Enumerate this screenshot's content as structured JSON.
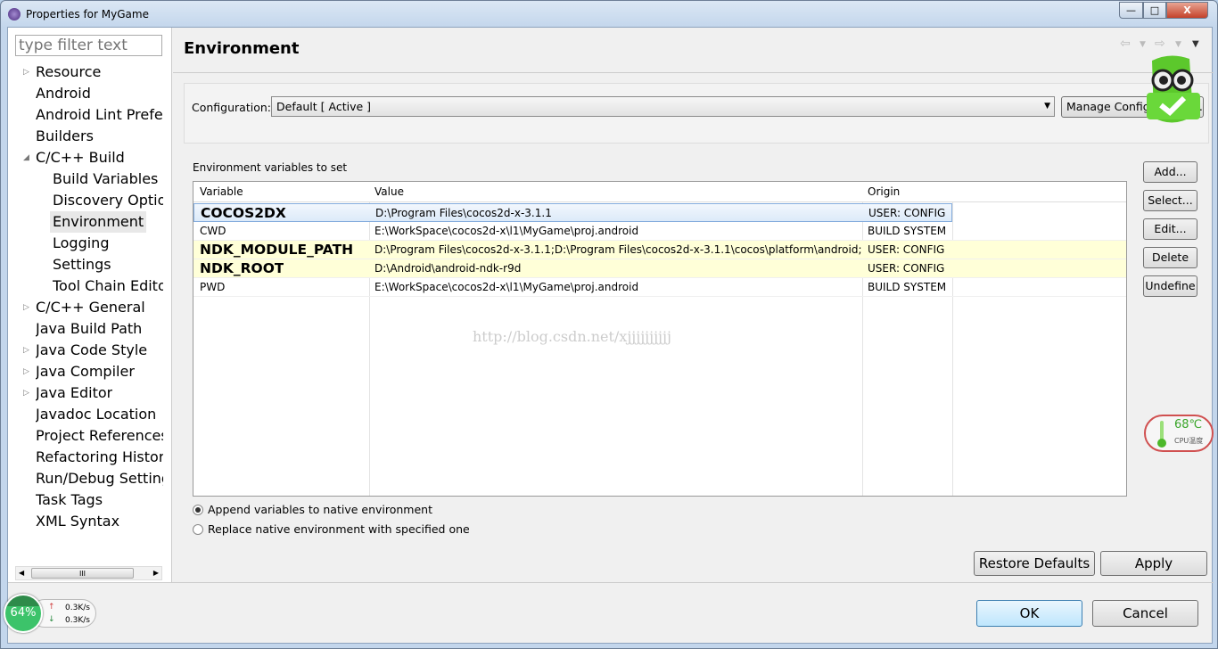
{
  "window": {
    "title": "Properties for MyGame",
    "minimize": "—",
    "maximize": "□",
    "close": "X"
  },
  "sidebar": {
    "filter_placeholder": "type filter text",
    "items": [
      {
        "label": "Resource",
        "level": 1,
        "expandable": true
      },
      {
        "label": "Android",
        "level": 1
      },
      {
        "label": "Android Lint Preferences",
        "level": 1
      },
      {
        "label": "Builders",
        "level": 1
      },
      {
        "label": "C/C++ Build",
        "level": 1,
        "expanded": true
      },
      {
        "label": "Build Variables",
        "level": 2
      },
      {
        "label": "Discovery Options",
        "level": 2
      },
      {
        "label": "Environment",
        "level": 2,
        "selected": true
      },
      {
        "label": "Logging",
        "level": 2
      },
      {
        "label": "Settings",
        "level": 2
      },
      {
        "label": "Tool Chain Editor",
        "level": 2
      },
      {
        "label": "C/C++ General",
        "level": 1,
        "expandable": true
      },
      {
        "label": "Java Build Path",
        "level": 1
      },
      {
        "label": "Java Code Style",
        "level": 1,
        "expandable": true
      },
      {
        "label": "Java Compiler",
        "level": 1,
        "expandable": true
      },
      {
        "label": "Java Editor",
        "level": 1,
        "expandable": true
      },
      {
        "label": "Javadoc Location",
        "level": 1
      },
      {
        "label": "Project References",
        "level": 1
      },
      {
        "label": "Refactoring History",
        "level": 1
      },
      {
        "label": "Run/Debug Settings",
        "level": 1
      },
      {
        "label": "Task Tags",
        "level": 1
      },
      {
        "label": "XML Syntax",
        "level": 1
      }
    ],
    "scroll_thumb": "III"
  },
  "main": {
    "title": "Environment",
    "configuration_label": "Configuration:",
    "configuration_value": "Default  [ Active ]",
    "manage_configurations": "Manage Configurations...",
    "section_label": "Environment variables to set",
    "table": {
      "columns": [
        "Variable",
        "Value",
        "Origin"
      ],
      "rows": [
        {
          "variable": "COCOS2DX",
          "value": "D:\\Program Files\\cocos2d-x-3.1.1",
          "origin": "USER: CONFIG",
          "user": true,
          "selected": true
        },
        {
          "variable": "CWD",
          "value": "E:\\WorkSpace\\cocos2d-x\\l1\\MyGame\\proj.android",
          "origin": "BUILD SYSTEM"
        },
        {
          "variable": "NDK_MODULE_PATH",
          "value": "D:\\Program Files\\cocos2d-x-3.1.1;D:\\Program Files\\cocos2d-x-3.1.1\\cocos\\platform\\android;",
          "origin": "USER: CONFIG",
          "user": true
        },
        {
          "variable": "NDK_ROOT",
          "value": "D:\\Android\\android-ndk-r9d",
          "origin": "USER: CONFIG",
          "user": true
        },
        {
          "variable": "PWD",
          "value": "E:\\WorkSpace\\cocos2d-x\\l1\\MyGame\\proj.android",
          "origin": "BUILD SYSTEM"
        }
      ]
    },
    "side_buttons": [
      "Add...",
      "Select...",
      "Edit...",
      "Delete",
      "Undefine"
    ],
    "radio_append": "Append variables to native environment",
    "radio_replace": "Replace native environment with specified one",
    "radio_selected": "append",
    "restore_defaults": "Restore Defaults",
    "apply": "Apply",
    "watermark": "http://blog.csdn.net/xjjjjjjjjjj"
  },
  "footer": {
    "ok": "OK",
    "cancel": "Cancel"
  },
  "overlays": {
    "cpu_temp": "68℃",
    "cpu_label": "CPU温度",
    "memory": "64%",
    "upload": "0.3K/s",
    "download": "0.3K/s"
  },
  "colors": {
    "user_row": "#ffffd8",
    "selection": "#dceaf9",
    "mascot": "#5cc82c"
  }
}
